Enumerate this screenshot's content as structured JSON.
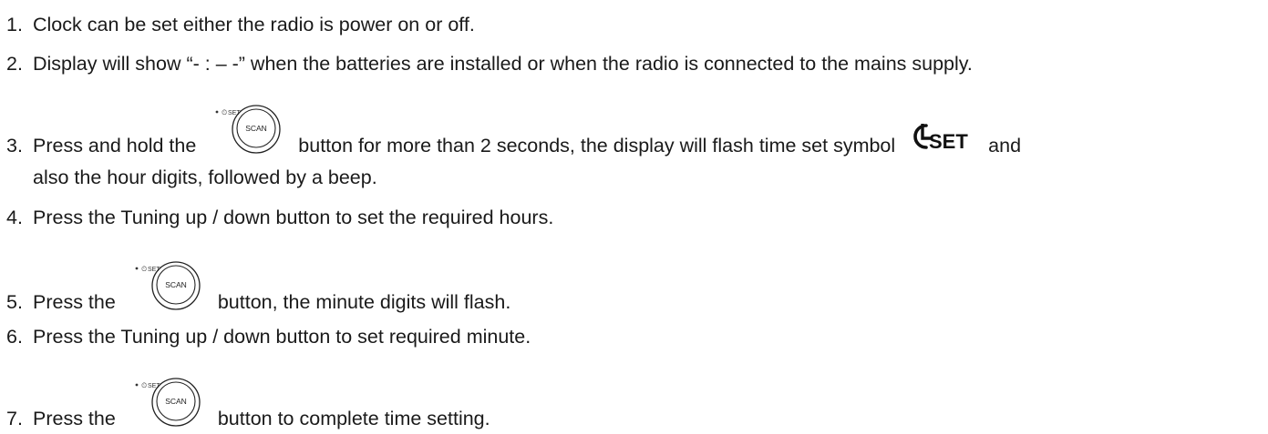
{
  "steps": [
    {
      "num": "1.",
      "text": "Clock can be set either the radio is power on or off."
    },
    {
      "num": "2.",
      "text": "Display will show “- : – -” when the batteries are installed or when the radio is connected to the mains supply."
    },
    {
      "num": "3.",
      "text_before": "Press and hold the",
      "text_middle": "button for more than 2 seconds, the display will flash time set symbol",
      "text_after": "and",
      "text_cont": "also the hour digits, followed by a beep."
    },
    {
      "num": "4.",
      "text": "Press the Tuning up / down button to set the required hours."
    },
    {
      "num": "5.",
      "text_before": "Press the",
      "text_after": "button, the minute digits will flash."
    },
    {
      "num": "6.",
      "text": "Press the Tuning up / down button to set required minute."
    },
    {
      "num": "7.",
      "text_before": "Press the",
      "text_after": "button to complete time setting."
    }
  ],
  "button_icon": {
    "label": "SCAN",
    "caption": "SET",
    "name": "scan-clock-set-button-icon"
  },
  "symbol": {
    "text": "SET",
    "name": "clock-set-symbol-icon"
  }
}
